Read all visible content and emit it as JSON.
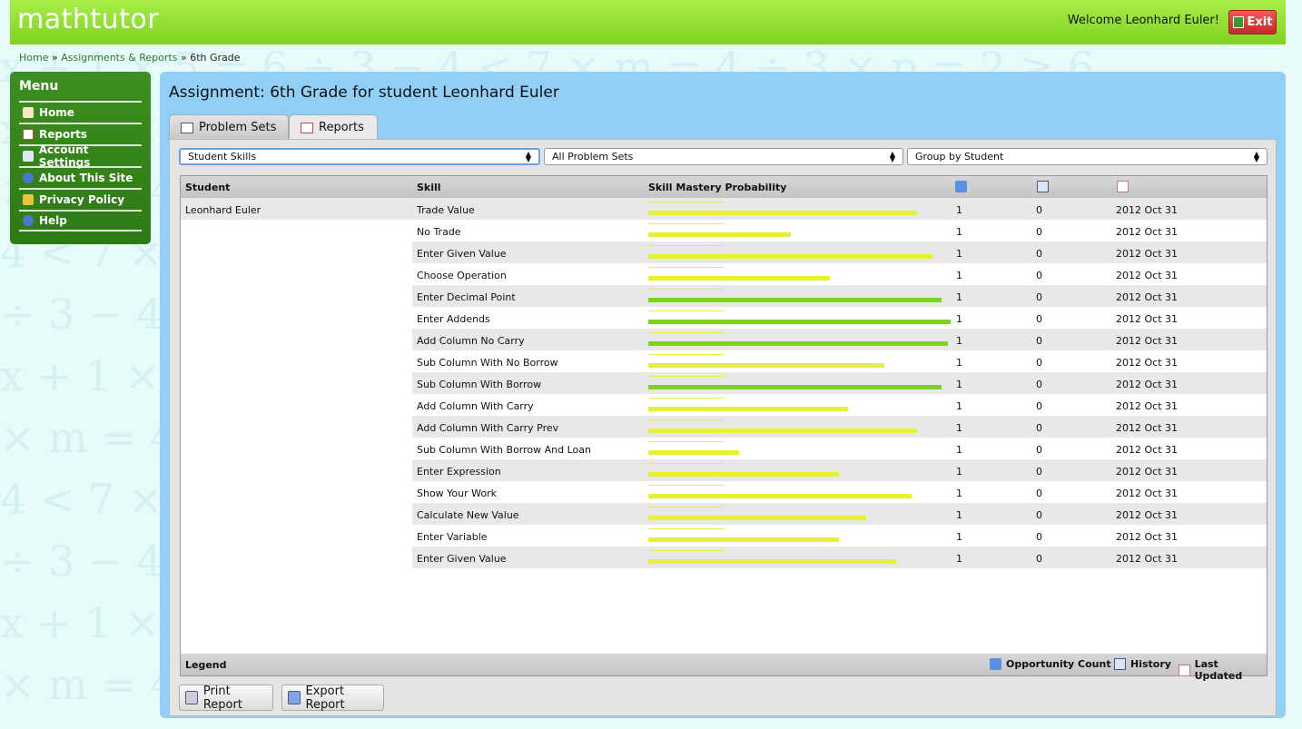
{
  "header": {
    "logo": "mathtutor",
    "welcome": "Welcome Leonhard Euler!",
    "exit_label": "Exit"
  },
  "breadcrumb": {
    "home": "Home",
    "sep1": "»",
    "assignments": "Assignments & Reports",
    "sep2": "»",
    "current": "6th Grade"
  },
  "menu": {
    "title": "Menu",
    "items": [
      {
        "label": "Home",
        "icon": "house-icon"
      },
      {
        "label": "Reports",
        "icon": "notebook-icon"
      },
      {
        "label": "Account Settings",
        "icon": "id-card-icon"
      },
      {
        "label": "About This Site",
        "icon": "info-icon"
      },
      {
        "label": "Privacy Policy",
        "icon": "shield-icon"
      },
      {
        "label": "Help",
        "icon": "help-icon"
      }
    ]
  },
  "page": {
    "title": "Assignment: 6th Grade for student Leonhard Euler",
    "tabs": [
      {
        "label": "Problem Sets"
      },
      {
        "label": "Reports"
      }
    ]
  },
  "filters": {
    "report_type": "Student Skills",
    "problem_sets": "All Problem Sets",
    "group_by": "Group by Student"
  },
  "table": {
    "headers": {
      "student": "Student",
      "skill": "Skill",
      "mastery": "Skill Mastery Probability"
    },
    "student": "Leonhard Euler",
    "rows": [
      {
        "skill": "Trade Value",
        "mastery": 0.89,
        "opp": "1",
        "hist": "0",
        "updated": "2012 Oct 31"
      },
      {
        "skill": "No Trade",
        "mastery": 0.47,
        "opp": "1",
        "hist": "0",
        "updated": "2012 Oct 31"
      },
      {
        "skill": "Enter Given Value",
        "mastery": 0.94,
        "opp": "1",
        "hist": "0",
        "updated": "2012 Oct 31"
      },
      {
        "skill": "Choose Operation",
        "mastery": 0.6,
        "opp": "1",
        "hist": "0",
        "updated": "2012 Oct 31"
      },
      {
        "skill": "Enter Decimal Point",
        "mastery": 0.97,
        "opp": "1",
        "hist": "0",
        "updated": "2012 Oct 31"
      },
      {
        "skill": "Enter Addends",
        "mastery": 1.0,
        "opp": "1",
        "hist": "0",
        "updated": "2012 Oct 31"
      },
      {
        "skill": "Add Column No Carry",
        "mastery": 0.99,
        "opp": "1",
        "hist": "0",
        "updated": "2012 Oct 31"
      },
      {
        "skill": "Sub Column With No Borrow",
        "mastery": 0.78,
        "opp": "1",
        "hist": "0",
        "updated": "2012 Oct 31"
      },
      {
        "skill": "Sub Column With Borrow",
        "mastery": 0.97,
        "opp": "1",
        "hist": "0",
        "updated": "2012 Oct 31"
      },
      {
        "skill": "Add Column With Carry",
        "mastery": 0.66,
        "opp": "1",
        "hist": "0",
        "updated": "2012 Oct 31"
      },
      {
        "skill": "Add Column With Carry Prev",
        "mastery": 0.89,
        "opp": "1",
        "hist": "0",
        "updated": "2012 Oct 31"
      },
      {
        "skill": "Sub Column With Borrow And Loan",
        "mastery": 0.3,
        "opp": "1",
        "hist": "0",
        "updated": "2012 Oct 31"
      },
      {
        "skill": "Enter Expression",
        "mastery": 0.63,
        "opp": "1",
        "hist": "0",
        "updated": "2012 Oct 31"
      },
      {
        "skill": "Show Your Work",
        "mastery": 0.87,
        "opp": "1",
        "hist": "0",
        "updated": "2012 Oct 31"
      },
      {
        "skill": "Calculate New Value",
        "mastery": 0.72,
        "opp": "1",
        "hist": "0",
        "updated": "2012 Oct 31"
      },
      {
        "skill": "Enter Variable",
        "mastery": 0.63,
        "opp": "1",
        "hist": "0",
        "updated": "2012 Oct 31"
      },
      {
        "skill": "Enter Given Value",
        "mastery": 0.82,
        "opp": "1",
        "hist": "0",
        "updated": "2012 Oct 31"
      }
    ]
  },
  "legend": {
    "title": "Legend",
    "opportunity": "Opportunity Count",
    "history": "History",
    "updated": "Last Updated"
  },
  "buttons": {
    "print": "Print Report",
    "export": "Export Report"
  },
  "colors": {
    "mastered": "#7ed321",
    "learning": "#e6ef3a",
    "header_green": "#8fdc2e",
    "main_blue": "#91cff7"
  }
}
